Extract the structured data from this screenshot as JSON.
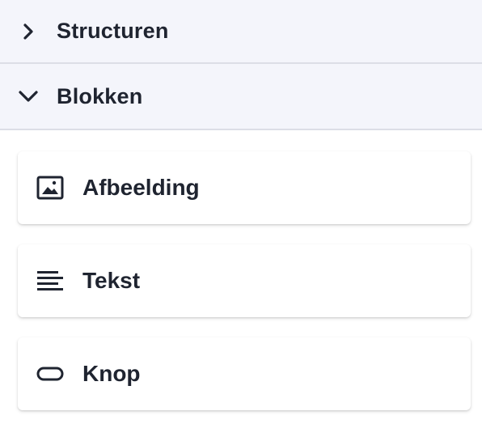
{
  "sections": [
    {
      "label": "Structuren",
      "state": "collapsed",
      "icon": "chevron-right-icon"
    },
    {
      "label": "Blokken",
      "state": "expanded",
      "icon": "chevron-down-icon"
    }
  ],
  "blocks": [
    {
      "label": "Afbeelding",
      "icon": "image-icon"
    },
    {
      "label": "Tekst",
      "icon": "text-lines-icon"
    },
    {
      "label": "Knop",
      "icon": "button-icon"
    }
  ]
}
